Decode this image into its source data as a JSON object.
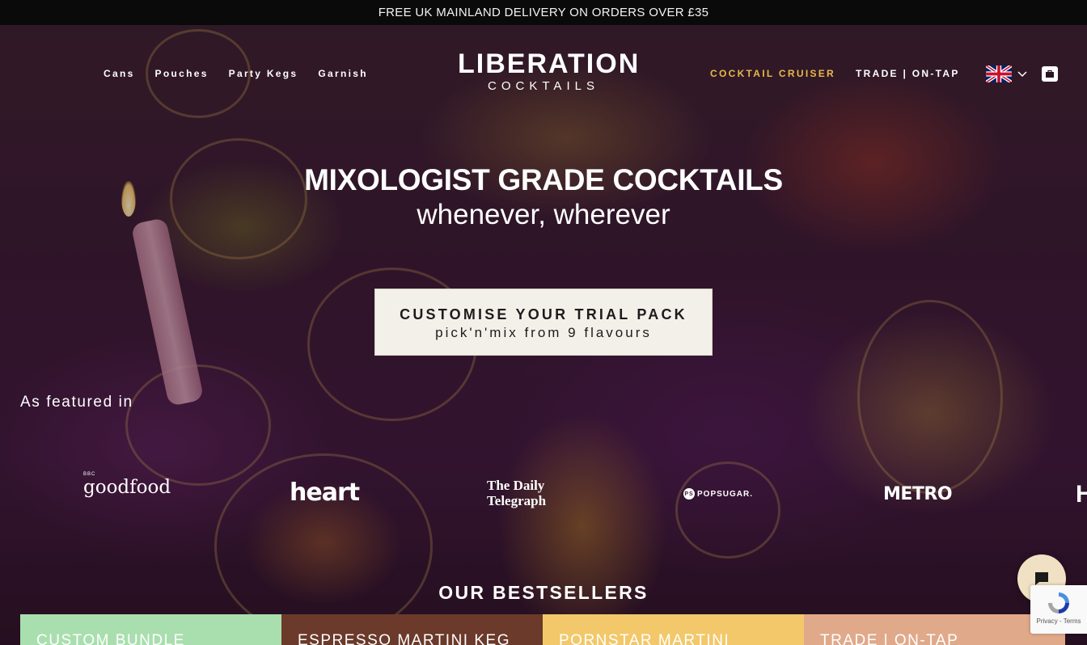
{
  "announcement": "FREE UK MAINLAND DELIVERY ON ORDERS OVER £35",
  "logo": {
    "main": "LIBERATION",
    "sub": "COCKTAILS"
  },
  "nav_left": [
    "Cans",
    "Pouches",
    "Party Kegs",
    "Garnish"
  ],
  "nav_right": [
    {
      "label": "COCKTAIL CRUISER",
      "accent": true
    },
    {
      "label": "TRADE | ON-TAP",
      "accent": false
    }
  ],
  "accent_color": "#e9b949",
  "hero": {
    "title": "MIXOLOGIST GRADE COCKTAILS",
    "subtitle": "whenever, wherever",
    "cta_line1": "CUSTOMISE YOUR TRIAL PACK",
    "cta_line2": "pick'n'mix from 9 flavours"
  },
  "featured_label": "As featured in",
  "press": {
    "goodfood_bbc": "BBC",
    "goodfood": "goodfood",
    "heart": "heart",
    "telegraph_1": "The Daily",
    "telegraph_2": "Telegraph",
    "popsugar_badge": "PS",
    "popsugar": "POPSUGAR.",
    "metro": "METRO",
    "cut": "H"
  },
  "bestsellers_title": "OUR BESTSELLERS",
  "cards": [
    "CUSTOM BUNDLE",
    "ESPRESSO MARTINI KEG",
    "PORNSTAR MARTINI",
    "TRADE | ON-TAP"
  ],
  "recaptcha_links": "Privacy - Terms",
  "icons": {
    "flag": "uk-flag-icon",
    "chevron": "chevron-down-icon",
    "cart": "shopping-bag-icon",
    "chat": "chat-icon"
  }
}
